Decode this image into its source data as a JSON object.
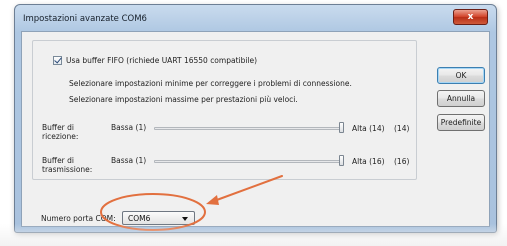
{
  "window": {
    "title": "Impostazioni avanzate COM6",
    "close_glyph": "x"
  },
  "fifo": {
    "label": "Usa buffer FIFO (richiede UART 16550 compatibile)",
    "checked": true
  },
  "hints": {
    "minimum": "Selezionare impostazioni minime per correggere i problemi di connessione.",
    "maximum": "Selezionare impostazioni massime per prestazioni più veloci."
  },
  "receive_buffer": {
    "label_line1": "Buffer di",
    "label_line2": "ricezione:",
    "low_label": "Bassa (1)",
    "high_label": "Alta (14)",
    "current_value": "(14)",
    "level_fraction": 1.0
  },
  "transmit_buffer": {
    "label_line1": "Buffer di",
    "label_line2": "trasmissione:",
    "low_label": "Bassa (1)",
    "high_label": "Alta (16)",
    "current_value": "(16)",
    "level_fraction": 1.0
  },
  "com_port": {
    "label": "Numero porta COM:",
    "selected": "COM6"
  },
  "buttons": {
    "ok": "OK",
    "cancel": "Annulla",
    "defaults": "Predefinite"
  },
  "annotation": {
    "color": "#e2703f",
    "shapes": [
      "ellipse",
      "arrow"
    ]
  }
}
